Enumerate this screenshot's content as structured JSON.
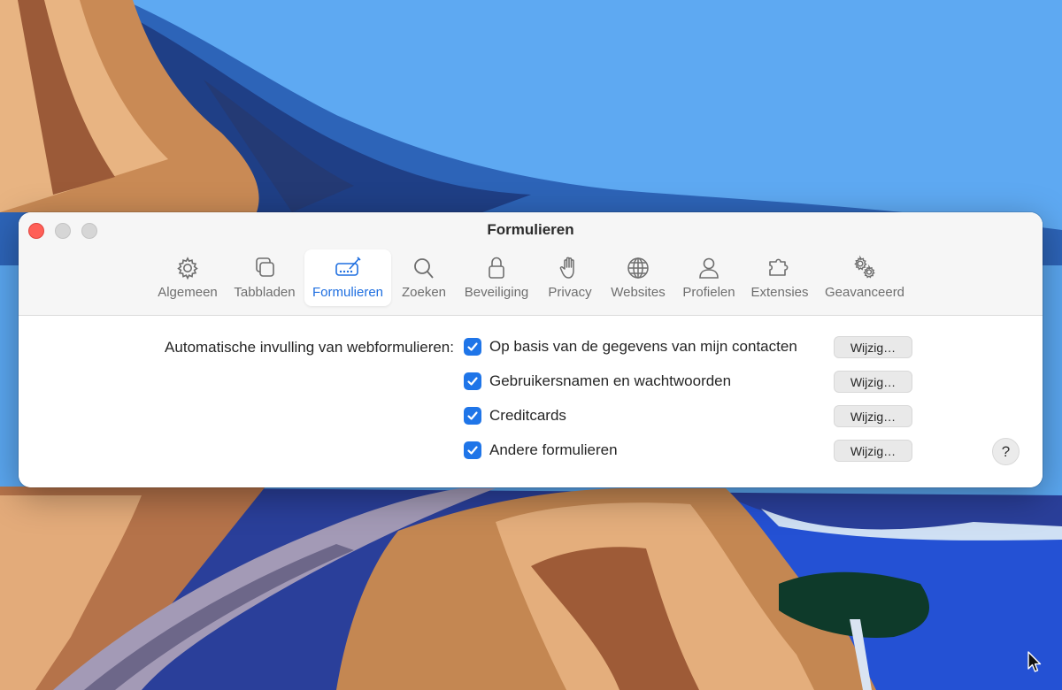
{
  "window": {
    "title": "Formulieren"
  },
  "toolbar": {
    "tabs": [
      {
        "label": "Algemeen",
        "icon": "gear-icon"
      },
      {
        "label": "Tabbladen",
        "icon": "tabs-icon"
      },
      {
        "label": "Formulieren",
        "icon": "form-pen-icon",
        "selected": true
      },
      {
        "label": "Zoeken",
        "icon": "search-icon"
      },
      {
        "label": "Beveiliging",
        "icon": "lock-icon"
      },
      {
        "label": "Privacy",
        "icon": "hand-icon"
      },
      {
        "label": "Websites",
        "icon": "globe-icon"
      },
      {
        "label": "Profielen",
        "icon": "person-icon"
      },
      {
        "label": "Extensies",
        "icon": "puzzle-icon"
      },
      {
        "label": "Geavanceerd",
        "icon": "gears-icon"
      }
    ]
  },
  "autofill": {
    "label": "Automatische invulling van webformulieren:",
    "options": [
      {
        "label": "Op basis van de gegevens van mijn contacten",
        "checked": true,
        "button": "Wijzig…"
      },
      {
        "label": "Gebruikersnamen en wachtwoorden",
        "checked": true,
        "button": "Wijzig…"
      },
      {
        "label": "Creditcards",
        "checked": true,
        "button": "Wijzig…"
      },
      {
        "label": "Andere formulieren",
        "checked": true,
        "button": "Wijzig…"
      }
    ]
  },
  "help": {
    "label": "?"
  },
  "colors": {
    "accent": "#1f75e8",
    "close": "#ff5f57"
  }
}
